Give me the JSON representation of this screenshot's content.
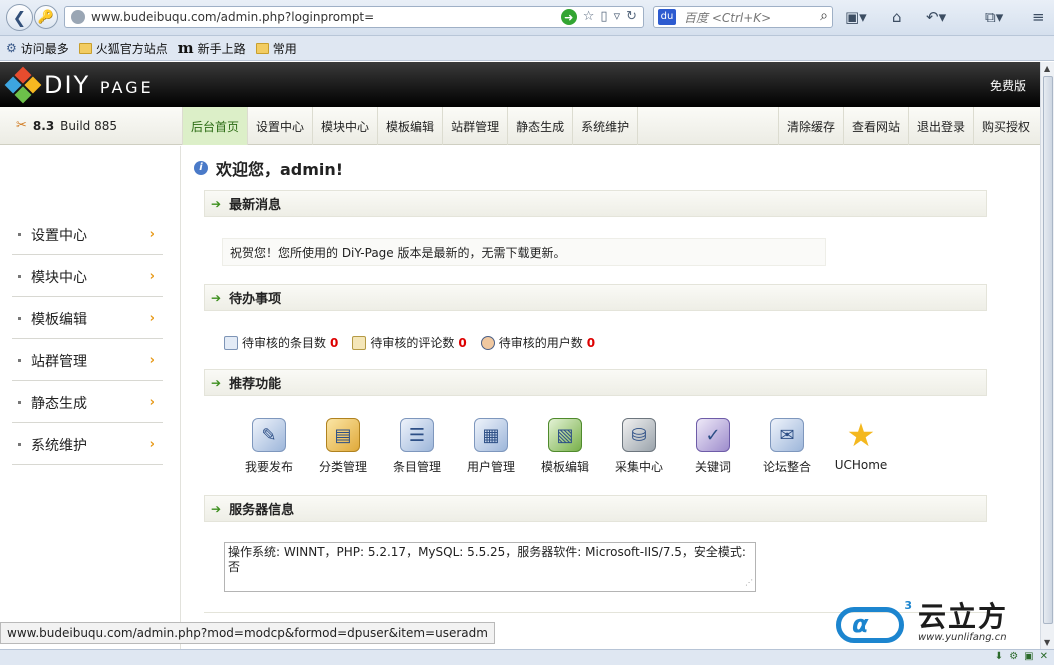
{
  "browser": {
    "url": "www.budeibuqu.com/admin.php?loginprompt=",
    "search_placeholder": "百度 <Ctrl+K>"
  },
  "bookmarks": [
    {
      "label": "访问最多"
    },
    {
      "label": "火狐官方站点"
    },
    {
      "label": "新手上路"
    },
    {
      "label": "常用"
    }
  ],
  "header": {
    "logo_main": "DIY",
    "logo_sub": "PAGE",
    "edition": "免费版"
  },
  "version": {
    "number": "8.3",
    "build": "Build 885"
  },
  "menu": {
    "left": [
      "后台首页",
      "设置中心",
      "模块中心",
      "模板编辑",
      "站群管理",
      "静态生成",
      "系统维护"
    ],
    "right": [
      "清除缓存",
      "查看网站",
      "退出登录",
      "购买授权"
    ],
    "active": "后台首页"
  },
  "sidebar": {
    "items": [
      "设置中心",
      "模块中心",
      "模板编辑",
      "站群管理",
      "静态生成",
      "系统维护"
    ]
  },
  "main": {
    "welcome": "欢迎您，admin!",
    "sections": {
      "news": "最新消息",
      "todo": "待办事项",
      "features": "推荐功能",
      "server": "服务器信息"
    },
    "news_text": "祝贺您！您所使用的 DiY-Page 版本是最新的，无需下载更新。",
    "todo_items": [
      {
        "label": "待审核的条目数",
        "count": "0"
      },
      {
        "label": "待审核的评论数",
        "count": "0"
      },
      {
        "label": "待审核的用户数",
        "count": "0"
      }
    ],
    "features": [
      {
        "label": "我要发布",
        "icon": "publish-icon"
      },
      {
        "label": "分类管理",
        "icon": "folder-icon"
      },
      {
        "label": "条目管理",
        "icon": "items-icon"
      },
      {
        "label": "用户管理",
        "icon": "users-icon"
      },
      {
        "label": "模板编辑",
        "icon": "template-icon"
      },
      {
        "label": "采集中心",
        "icon": "collect-icon"
      },
      {
        "label": "关键词",
        "icon": "keyword-icon"
      },
      {
        "label": "论坛整合",
        "icon": "forum-icon"
      },
      {
        "label": "UCHome",
        "icon": "star-icon"
      }
    ],
    "server_info": "操作系统: WINNT，PHP: 5.2.17，MySQL: 5.5.25，服务器软件: Microsoft-IIS/7.5，安全模式: 否"
  },
  "status": {
    "hover_url": "www.budeibuqu.com/admin.php?mod=modcp&formod=dpuser&item=useradm"
  },
  "watermark": {
    "badge": "3",
    "name": "云立方",
    "url": "www.yunlifang.cn"
  }
}
